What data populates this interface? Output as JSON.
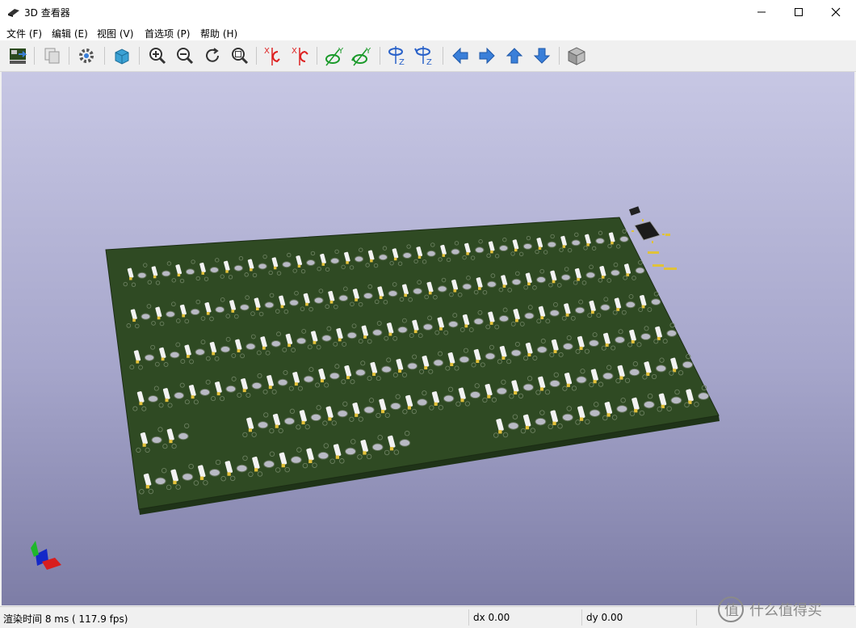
{
  "window": {
    "title": "3D 查看器",
    "controls": [
      "minimize-icon",
      "maximize-icon",
      "close-icon"
    ]
  },
  "menu": [
    {
      "label": "文件 (F)"
    },
    {
      "label": "编辑 (E)"
    },
    {
      "label": "视图 (V)"
    },
    {
      "label": "首选项 (P)"
    },
    {
      "label": "帮助 (H)"
    }
  ],
  "toolbar": [
    "reload-board-icon",
    "copy-image-icon",
    "settings-gear-icon",
    "render-mode-cube-icon",
    "zoom-in-icon",
    "zoom-out-icon",
    "redraw-icon",
    "zoom-fit-icon",
    "rotate-x-cw-icon",
    "rotate-x-ccw-icon",
    "rotate-y-cw-icon",
    "rotate-y-ccw-icon",
    "rotate-z-cw-icon",
    "rotate-z-ccw-icon",
    "move-left-icon",
    "move-right-icon",
    "move-up-icon",
    "move-down-icon",
    "orthographic-icon"
  ],
  "colors": {
    "board": "#2f4a23",
    "board_edge": "#1f3318",
    "bg_top": "#c7c7e4",
    "bg_bottom": "#7d7da6",
    "accent": "#3a7fd9"
  },
  "status": {
    "render": "渲染时间 8 ms ( 117.9 fps)",
    "dx": "dx 0.00",
    "dy": "dy 0.00"
  },
  "watermark": "什么值得买"
}
